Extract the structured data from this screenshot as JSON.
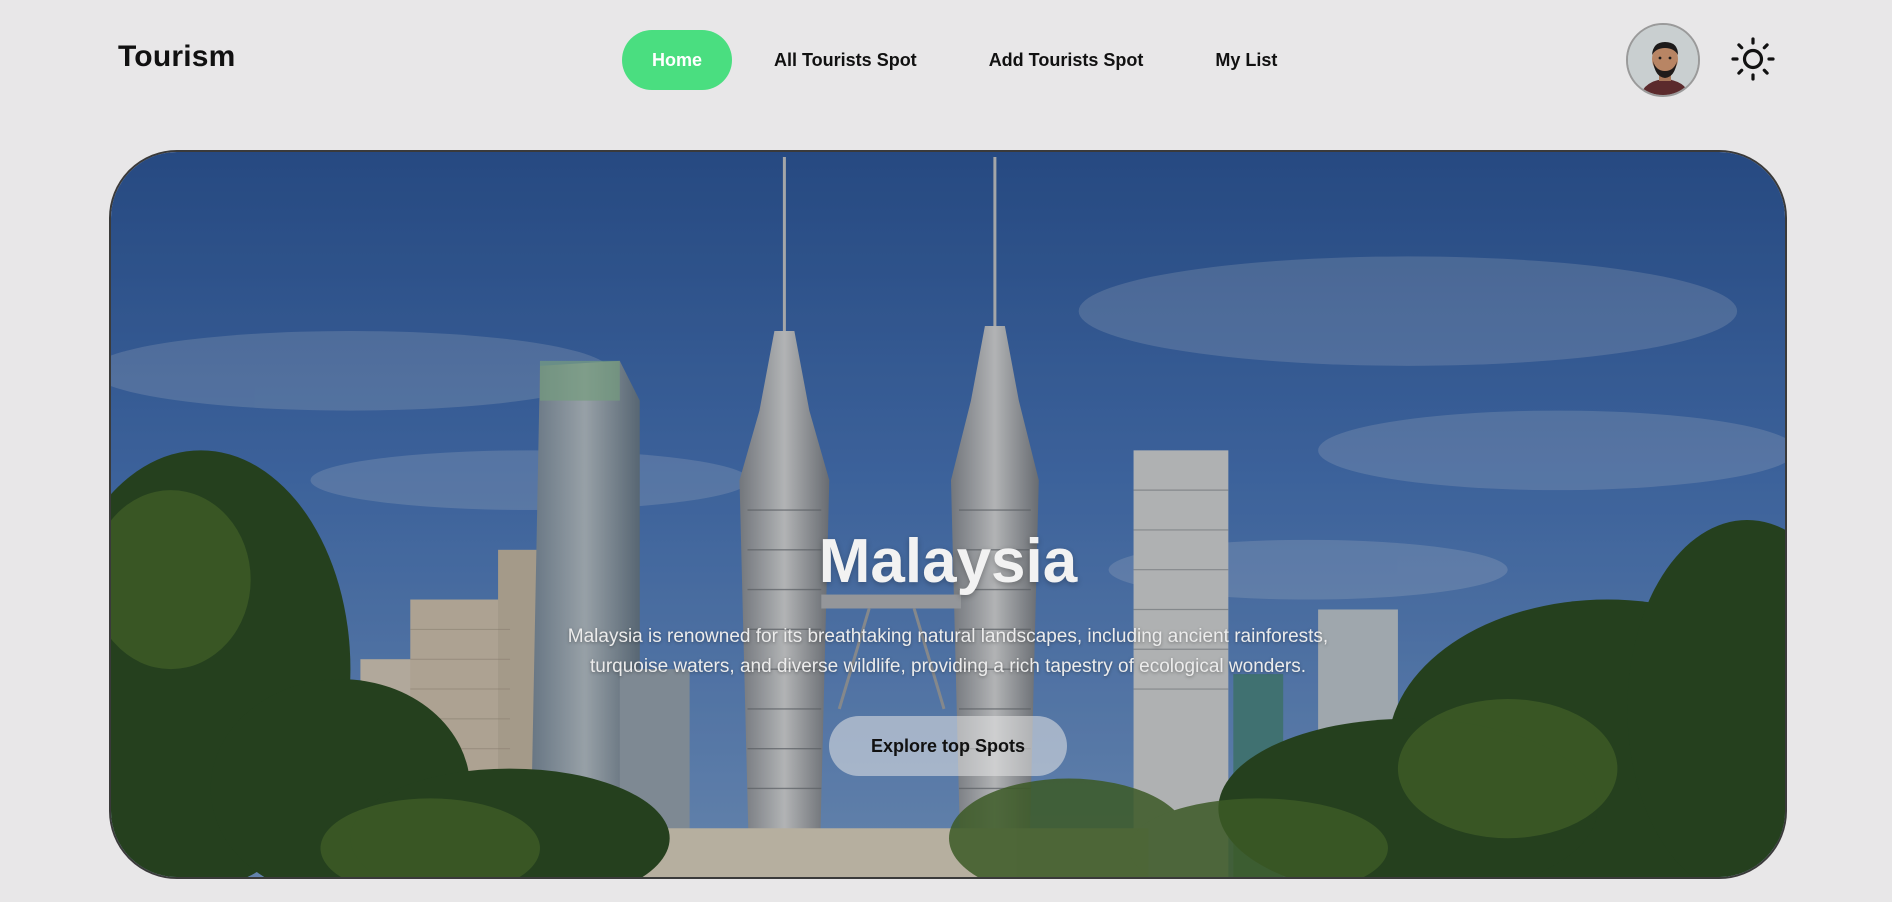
{
  "brand": {
    "name": "Tourism"
  },
  "nav": {
    "items": [
      {
        "label": "Home",
        "active": true
      },
      {
        "label": "All Tourists Spot",
        "active": false
      },
      {
        "label": "Add Tourists Spot",
        "active": false
      },
      {
        "label": "My List",
        "active": false
      }
    ]
  },
  "header": {
    "avatar_icon": "user-avatar",
    "theme_icon": "sun-icon"
  },
  "hero": {
    "title": "Malaysia",
    "description": "Malaysia is renowned for its breathtaking natural landscapes, including ancient rainforests, turquoise waters, and diverse wildlife, providing a rich tapestry of ecological wonders.",
    "button_label": "Explore top Spots"
  },
  "colors": {
    "accent": "#4ade80",
    "background": "#e8e7e8",
    "text": "#111111"
  }
}
